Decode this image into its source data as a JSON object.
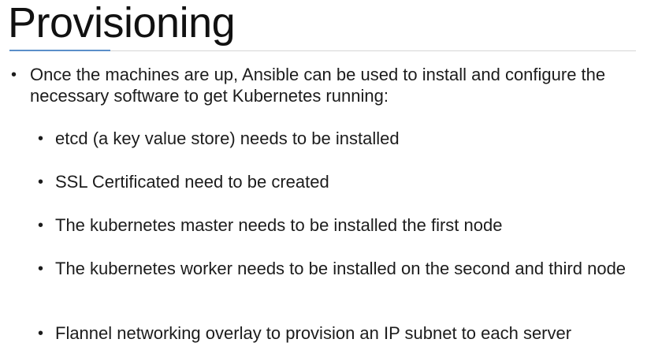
{
  "slide": {
    "title": "Provisioning",
    "main_bullet": "Once the machines are up, Ansible can be used to install and configure the necessary software to get Kubernetes running:",
    "sub_bullets": [
      "etcd (a key value store) needs to be installed",
      "SSL Certificated need to be created",
      "The kubernetes master needs to be installed the first node",
      "The kubernetes worker needs to be installed on the second and third node",
      "Flannel networking overlay to provision an IP subnet to each server"
    ],
    "bullet_glyph": "•"
  },
  "colors": {
    "accent_rule": "#5b8fc9",
    "divider": "#d6d6d6",
    "text": "#1c1c1c"
  }
}
